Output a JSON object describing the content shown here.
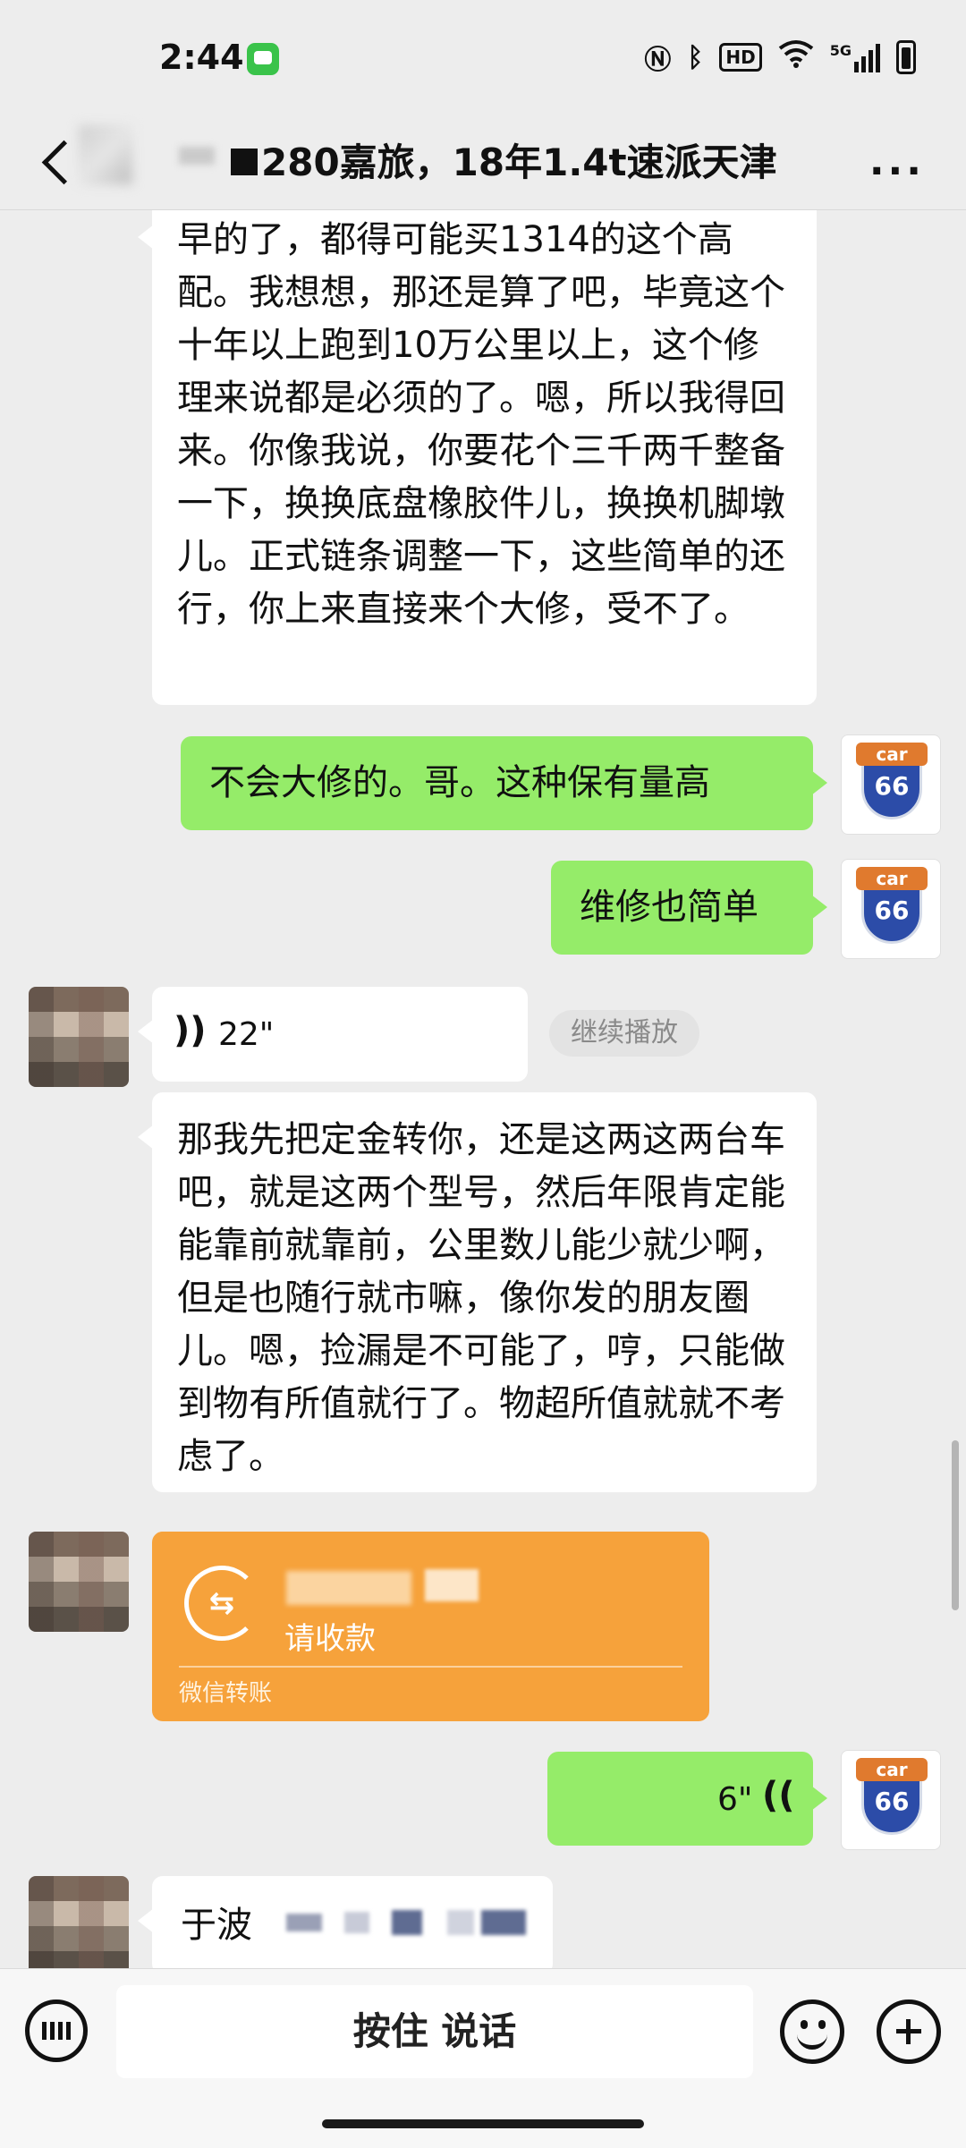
{
  "status_bar": {
    "time": "2:44",
    "network": "5G",
    "hd": "HD"
  },
  "header": {
    "title": "280嘉旅，18年1.4t速派天津",
    "more": "···"
  },
  "messages": {
    "m1_text": "早的了，都得可能买1314的这个高配。我想想，那还是算了吧，毕竟这个十年以上跑到10万公里以上，这个修理来说都是必须的了。嗯，所以我得回来。你像我说，你要花个三千两千整备一下，换换底盘橡胶件儿，换换机脚墩儿。正式链条调整一下，这些简单的还行，你上来直接来个大修，受不了。",
    "m2_text": "不会大修的。哥。这种保有量高",
    "m3_text": "维修也简单",
    "m4_voice": "22\"",
    "m4_continue": "继续播放",
    "m5_text": "那我先把定金转你，还是这两这两台车吧，就是这两个型号，然后年限肯定能能靠前就靠前，公里数儿能少就少啊，但是也随行就市嘛，像你发的朋友圈儿。嗯，捡漏是不可能了，哼，只能做到物有所值就行了。物超所值就就不考虑了。",
    "m6_transfer_status": "请收款",
    "m6_transfer_footer": "微信转账",
    "m7_voice": "6\"",
    "m8_text": "于波"
  },
  "avatars": {
    "car_badge_top": "car",
    "car_badge_num": "66"
  },
  "input_bar": {
    "talk_label": "按住 说话"
  },
  "colors": {
    "outgoing_bubble": "#95ec69",
    "incoming_bubble": "#ffffff",
    "transfer_card": "#f6a23b",
    "background": "#ededed"
  }
}
